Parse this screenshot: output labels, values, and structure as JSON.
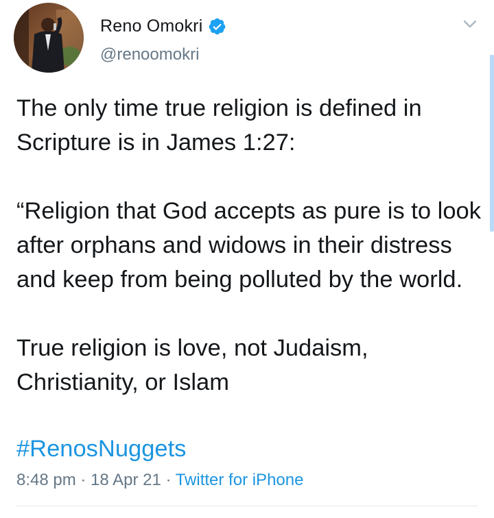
{
  "tweet": {
    "author": {
      "display_name": "Reno Omokri",
      "handle": "@renoomokri",
      "verified": true
    },
    "lines": [
      "The only time true religion is defined in",
      "Scripture is in James 1:27:",
      "",
      "“Religion that God accepts as pure is to look",
      "after orphans and widows in their distress",
      "and keep from being polluted by the world.",
      "",
      "True religion is love, not Judaism,",
      "Christianity, or Islam"
    ],
    "hashtag": "#RenosNuggets",
    "time": "8:48 pm",
    "date": "18 Apr 21",
    "separator": " · ",
    "source": "Twitter for iPhone"
  },
  "colors": {
    "text": "#14171a",
    "secondary": "#657786",
    "link": "#1b95e0",
    "verified": "#1da1f2",
    "divider": "#e1e8ed"
  },
  "icons": {
    "verified": "verified-badge-icon",
    "menu": "chevron-down-icon"
  }
}
